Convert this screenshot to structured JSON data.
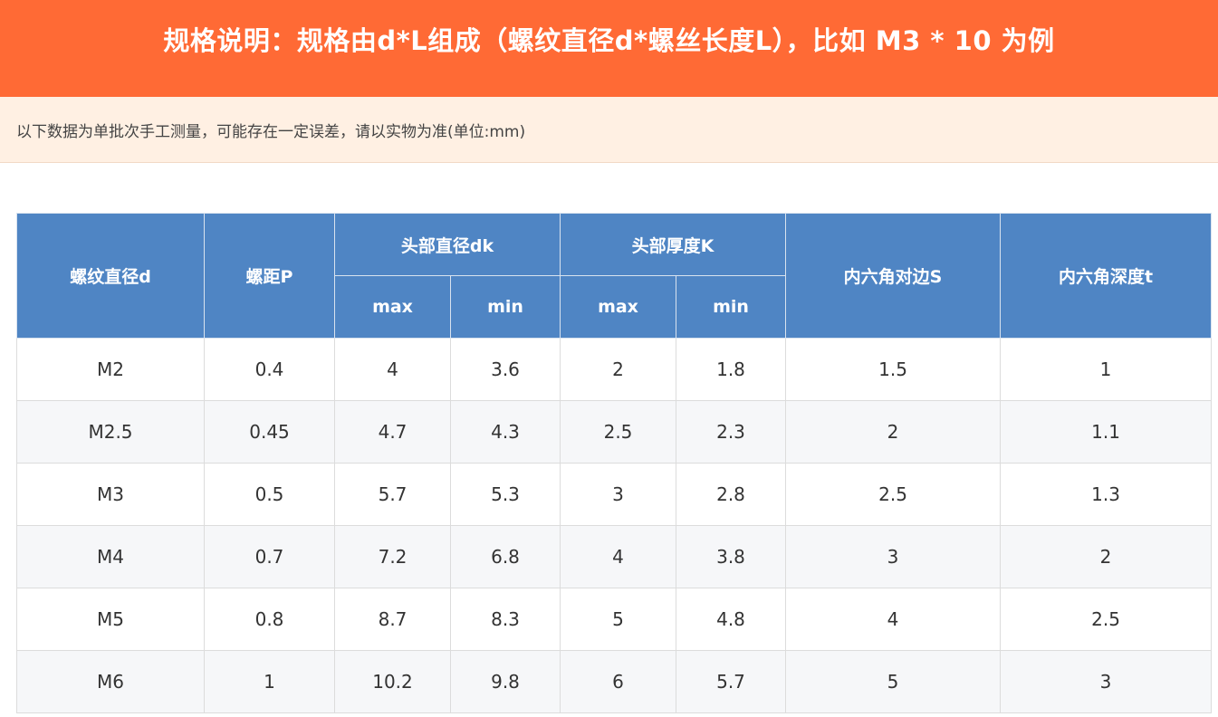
{
  "banner": {
    "title": "规格说明：规格由d*L组成（螺纹直径d*螺丝长度L），比如 M3 * 10 为例",
    "color": "#ff6a35"
  },
  "note": {
    "text": "以下数据为单批次手工测量，可能存在一定误差，请以实物为准(单位:mm)",
    "background": "#fff0e3"
  },
  "table": {
    "header_color": "#4f85c4",
    "headers": {
      "thread_diameter": "螺纹直径d",
      "pitch": "螺距P",
      "head_diameter": "头部直径dk",
      "head_thickness": "头部厚度K",
      "hex_across_flats": "内六角对边S",
      "hex_depth": "内六角深度t",
      "max": "max",
      "min": "min"
    },
    "rows": [
      [
        "M2",
        "0.4",
        "4",
        "3.6",
        "2",
        "1.8",
        "1.5",
        "1"
      ],
      [
        "M2.5",
        "0.45",
        "4.7",
        "4.3",
        "2.5",
        "2.3",
        "2",
        "1.1"
      ],
      [
        "M3",
        "0.5",
        "5.7",
        "5.3",
        "3",
        "2.8",
        "2.5",
        "1.3"
      ],
      [
        "M4",
        "0.7",
        "7.2",
        "6.8",
        "4",
        "3.8",
        "3",
        "2"
      ],
      [
        "M5",
        "0.8",
        "8.7",
        "8.3",
        "5",
        "4.8",
        "4",
        "2.5"
      ],
      [
        "M6",
        "1",
        "10.2",
        "9.8",
        "6",
        "5.7",
        "5",
        "3"
      ]
    ]
  }
}
